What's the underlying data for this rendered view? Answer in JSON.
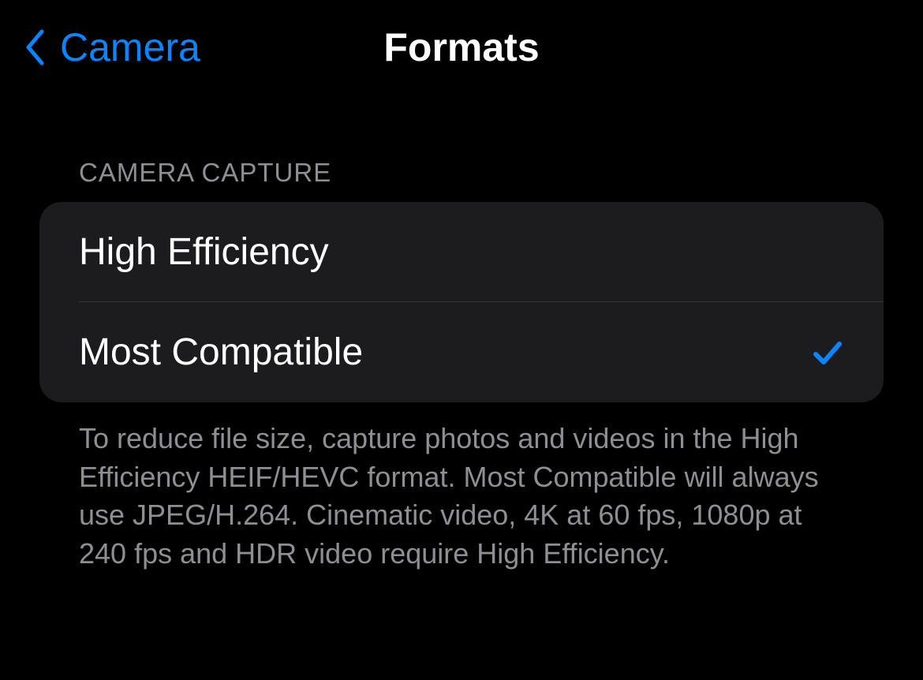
{
  "header": {
    "back_label": "Camera",
    "title": "Formats"
  },
  "section": {
    "header": "CAMERA CAPTURE",
    "options": [
      {
        "label": "High Efficiency",
        "selected": false
      },
      {
        "label": "Most Compatible",
        "selected": true
      }
    ],
    "footer": "To reduce file size, capture photos and videos in the High Efficiency HEIF/HEVC format. Most Compatible will always use JPEG/H.264. Cinematic video, 4K at 60 fps, 1080p at 240 fps and HDR video require High Efficiency."
  },
  "colors": {
    "accent": "#0a84ff",
    "background": "#000000",
    "group_background": "#1c1c1e",
    "text_primary": "#ffffff",
    "text_secondary": "#8e8e93"
  }
}
